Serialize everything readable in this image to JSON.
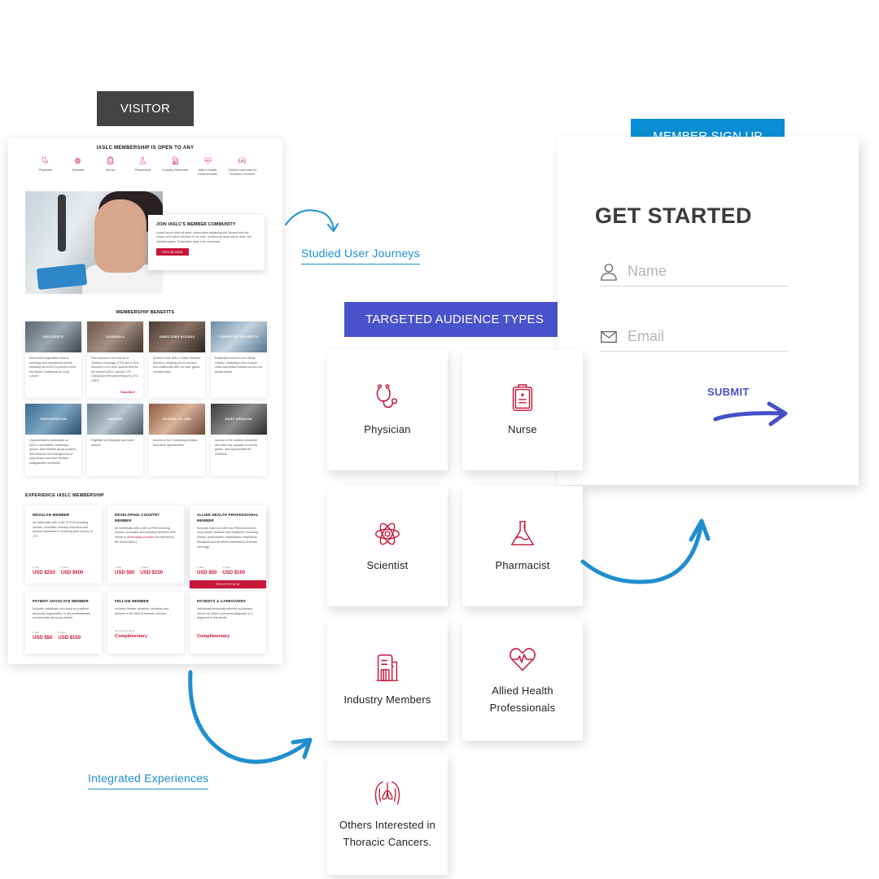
{
  "colors": {
    "visitor_tag": "#434343",
    "signup_tag": "#0a8ed3",
    "audience_tag": "#4a52cb",
    "brand_red": "#c8163a",
    "arrow_blue": "#1e8ecf",
    "submit_blue": "#4650c8"
  },
  "tags": {
    "visitor": "VISITOR",
    "member_sign_up": "MEMBER SIGN UP",
    "targeted_audience": "TARGETED AUDIENCE TYPES"
  },
  "annotations": {
    "studied_journeys": "Studied User Journeys",
    "integrated_experiences": "Integrated Experiences"
  },
  "visitor_page": {
    "open_title": "IASLC MEMBERSHIP IS OPEN TO ANY",
    "audiences": [
      {
        "label": "Physician",
        "icon": "stethoscope-icon"
      },
      {
        "label": "Scientist",
        "icon": "atom-icon"
      },
      {
        "label": "Nurse",
        "icon": "clipboard-icon"
      },
      {
        "label": "Pharmacist",
        "icon": "flask-icon"
      },
      {
        "label": "Industry Members",
        "icon": "building-icon"
      },
      {
        "label": "Allied Health Professionals",
        "icon": "heart-pulse-icon"
      },
      {
        "label": "Others Interested in Thoracic Cancers.",
        "icon": "lungs-icon"
      }
    ],
    "join": {
      "title": "JOIN IASLC'S MEMBER COMMUNITY",
      "body": "Lorem ipsum dolor sit amet, consectetur adipiscing elit. Aenean sed dui ornare velit luctus interdum et vel eros. Vivamus sit amet rutrum ante, nec ultricies sapien. Ut faucibus risus a leo commodo.",
      "button": "EXPLORE MORE"
    },
    "benefits_title": "MEMBERSHIP BENEFITS",
    "benefits": [
      {
        "label": "DISCOUNTS",
        "text": "Discounted registration fees to meetings and educational events, including the IASLC's premier event, the World Conference on Lung Cancer.",
        "more": ""
      },
      {
        "label": "JOURNALS",
        "text": "Free access to the Journal of Thoracic Oncology (JTO) and a 25% discount to the open-access fees for the newest IASLC journal, JTO Clinical and Research Reports (JTO CRR).",
        "more": "Read More →"
      },
      {
        "label": "DIRECTORY ACCESS",
        "text": "Access to the IASLC Online Member Directory, allowing you to connect and collaborate with our vast, global member base",
        "more": ""
      },
      {
        "label": "COMPUTER PROJECTS",
        "text": "Expanded access to the Virtual Library—featuring a mix of audio, video and lecture content across our global events",
        "more": ""
      },
      {
        "label": "PARTICIPATION",
        "text": "Opportunities to participate on IASLC committees, leadership groups, and member-group projects that influence the management of lung cancer and other thoracic malignancies worldwide",
        "more": ""
      },
      {
        "label": "AWARDS",
        "text": "Eligibility for fellowship and travel awards",
        "more": ""
      },
      {
        "label": "ACCESS TO CME",
        "text": "Access to free Continuing Medical Education opportunities",
        "more": ""
      },
      {
        "label": "EASY UPDATES",
        "text": "Access to the monthly newsletter and other key updates on events, grants, and opportunities for members",
        "more": ""
      }
    ],
    "experience_title": "EXPERIENCE IASLC MEMBERSHIP",
    "memberships": [
      {
        "title": "REGULAR MEMBER",
        "desc": "All individuals with a MD or PhD including doctors, scientists, industry members and anyone interested in receiving print version of JTO",
        "link": "",
        "desc_after": "",
        "p1_label": "1 Year",
        "p1": "USD $250",
        "p2_label": "2 Years",
        "p2": "USD $600",
        "complimentary": "",
        "comp_note": "",
        "register": ""
      },
      {
        "title": "DEVELOPING COUNTRY MEMBER",
        "desc": "All individuals with a MD or PhD including doctors, scientists and industry members who reside in ",
        "link": "developing countries",
        "desc_after": " (as defined by the World Bank.)",
        "p1_label": "1 Year",
        "p1": "USD $50",
        "p2_label": "2 Years",
        "p2": "USD $150",
        "complimentary": "",
        "comp_note": "",
        "register": ""
      },
      {
        "title": "ALLIED HEALTH PROFESSIONAL MEMBER",
        "desc": "Includes most non-MD/non-PhDs involved in lung cancer research and treatment, including nurses, pharmacists, statisticians, respiratory therapists and all others interested in thoracic oncology.",
        "link": "",
        "desc_after": "",
        "p1_label": "1 Year",
        "p1": "USD $50",
        "p2_label": "2 Years",
        "p2": "USD $150",
        "complimentary": "",
        "comp_note": "",
        "register": "REGISTER NOW"
      },
      {
        "title": "PATIENT ADVOCATE MEMBER",
        "desc": "Includes individuals who work for a patient advocacy organization or are professionally involved with advocacy efforts.",
        "link": "",
        "desc_after": "",
        "p1_label": "1 Year",
        "p1": "USD $50",
        "p2_label": "2 Years",
        "p2": "USD $150",
        "complimentary": "",
        "comp_note": "",
        "register": ""
      },
      {
        "title": "FELLOW MEMBER",
        "desc": "Includes fellows, students, residents and trainees in the field of thoracic cancers.",
        "link": "",
        "desc_after": "",
        "p1_label": "",
        "p1": "",
        "p2_label": "",
        "p2": "",
        "complimentary": "Complimentary",
        "comp_note": "For up to two terms",
        "register": ""
      },
      {
        "title": "PATIENTS & CAREGIVERS",
        "desc": "Individuals personally affected by thoracic cancer by either a personal diagnosis or a diagnosis in the family.",
        "link": "",
        "desc_after": "",
        "p1_label": "",
        "p1": "",
        "p2_label": "",
        "p2": "",
        "complimentary": "Complimentary",
        "comp_note": "",
        "register": ""
      }
    ]
  },
  "audience_cards": [
    {
      "label": "Physician",
      "icon": "stethoscope-icon"
    },
    {
      "label": "Nurse",
      "icon": "clipboard-icon"
    },
    {
      "label": "Scientist",
      "icon": "atom-icon"
    },
    {
      "label": "Pharmacist",
      "icon": "flask-icon"
    },
    {
      "label": "Industry Members",
      "icon": "building-icon"
    },
    {
      "label": "Allied Health Professionals",
      "icon": "heart-pulse-icon"
    },
    {
      "label": "Others Interested in Thoracic Cancers.",
      "icon": "lungs-icon"
    }
  ],
  "signup": {
    "title": "GET STARTED",
    "name_placeholder": "Name",
    "email_placeholder": "Email",
    "submit": "SUBMIT"
  }
}
